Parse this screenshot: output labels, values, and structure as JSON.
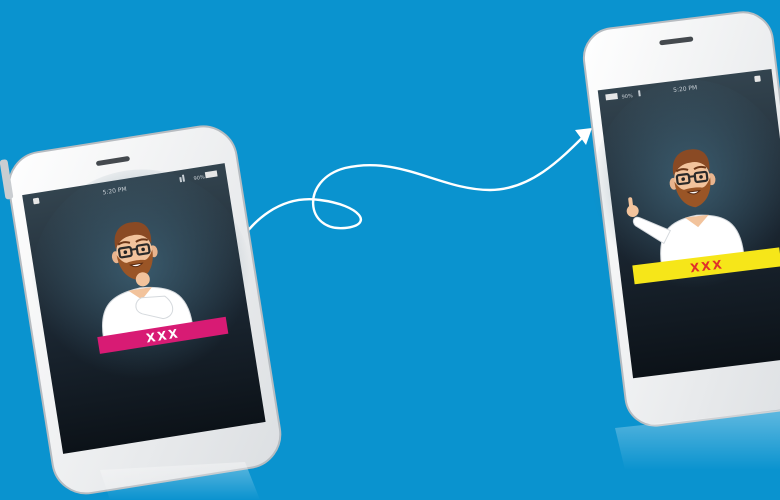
{
  "scene": {
    "background_color": "#0a93cf",
    "arrow_color": "#ffffff"
  },
  "phone_left": {
    "status_time": "5:20 PM",
    "status_battery": "90%",
    "banner_text": "XXX",
    "banner_color": "#d81b74",
    "banner_text_color": "#ffffff",
    "character_pose": "thinking"
  },
  "phone_right": {
    "status_time": "5:20 PM",
    "status_battery": "90%",
    "banner_text": "XXX",
    "banner_color": "#f6e619",
    "banner_text_color": "#e0302a",
    "character_pose": "pointing"
  }
}
